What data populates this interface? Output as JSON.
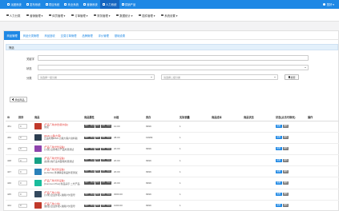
{
  "topbar": {
    "nav": [
      {
        "label": "派团系统",
        "icon": "grid-icon"
      },
      {
        "label": "发布系统",
        "icon": "send-icon"
      },
      {
        "label": "项目系统",
        "icon": "folder-icon"
      },
      {
        "label": "商业系统",
        "icon": "cart-icon"
      },
      {
        "label": "营销系统",
        "icon": "chart-icon"
      },
      {
        "label": "人力系统",
        "icon": "people-icon"
      },
      {
        "label": "供销产品",
        "icon": "box-icon"
      }
    ],
    "active_index": 5,
    "user": "您好 ▾"
  },
  "secbar": {
    "nav": [
      {
        "label": "人力分类"
      },
      {
        "label": "营销管理 ▾"
      },
      {
        "label": "体员管理 ▾"
      },
      {
        "label": "订单管理 ▾"
      },
      {
        "label": "财务管理 ▾"
      },
      {
        "label": "数据统计 ▾"
      },
      {
        "label": "插件管理 ▾"
      },
      {
        "label": "系统设置 ▾"
      }
    ]
  },
  "tabs": [
    {
      "label": "商品管理"
    },
    {
      "label": "商品分类管理"
    },
    {
      "label": "商品回收"
    },
    {
      "label": "交易订单管理"
    },
    {
      "label": "品牌管理"
    },
    {
      "label": "评价管理"
    },
    {
      "label": "基础设置"
    }
  ],
  "filter": {
    "title": "筛选",
    "keyword_label": "关键字",
    "status_label": "状态",
    "category_label": "分类",
    "category1_placeholder": "请选择一级分类",
    "category2_placeholder": "请选择二级分类",
    "search_label": "搜索"
  },
  "add_button": "添加商品",
  "table": {
    "headers": [
      "ID",
      "排序",
      "商品",
      "",
      "商品属性",
      "价格",
      "库存",
      "实际销量",
      "商品成本",
      "商品状态",
      "状态(点击可修改)",
      "操作"
    ],
    "attr_labels": [
      "推荐",
      "新品",
      "热卖",
      "包邮",
      "精品"
    ],
    "actions": {
      "edit": "编辑",
      "delete": "删除"
    },
    "rows": [
      {
        "id": "451",
        "sort": "0",
        "category": "[产品厂商|亦然|易尔康|]",
        "name": "测试",
        "price": "10.00",
        "stock": "9999",
        "sales": "1",
        "thumb": "#c0392b"
      },
      {
        "id": "450",
        "sort": "0",
        "category": "[RAD-公路|大客]",
        "name": "正品利用RAD-公路大客户资料版",
        "price": "38.00",
        "stock": "19999",
        "sales": "1",
        "thumb": "#2c3e50"
      },
      {
        "id": "449",
        "sort": "0",
        "category": "[产品厂商|光伏设备]",
        "name": "[小奖] 全新电子产品外观测试",
        "price": "20.00",
        "stock": "9999",
        "sales": "1",
        "thumb": "#8e44ad"
      },
      {
        "id": "448",
        "sort": "0",
        "category": "[产品厂商|光伏设备]",
        "name": "[荣誉] 热行业内部用外观测试",
        "price": "20.00",
        "stock": "9999",
        "sales": "1",
        "thumb": "#16a085"
      },
      {
        "id": "447",
        "sort": "0",
        "category": "[产品厂商|光伏设备]",
        "name": "[Lohmite] 鼻涕联名新品外观测试",
        "price": "20.00",
        "stock": "9999",
        "sales": "1",
        "thumb": "#2980b9"
      },
      {
        "id": "446",
        "sort": "0",
        "category": "[产品厂商|光伏设备]",
        "name": "[Common Plus] 新品演示 二代产品",
        "price": "20.00",
        "stock": "9999",
        "sales": "1",
        "thumb": "#1abc9c"
      },
      {
        "id": "445",
        "sort": "0",
        "category": "[产品厂商|小米]",
        "name": "[小米] 企业外观+通用户外型号",
        "price": "3000.00",
        "stock": "9999",
        "sales": "1",
        "thumb": "#34495e"
      },
      {
        "id": "444",
        "sort": "0",
        "category": "[产品厂商|小米]",
        "name": "[童话] 企业外观+通用户外型号",
        "price": "1000.00",
        "stock": "9999",
        "sales": "1",
        "thumb": "#c0392b"
      }
    ]
  }
}
